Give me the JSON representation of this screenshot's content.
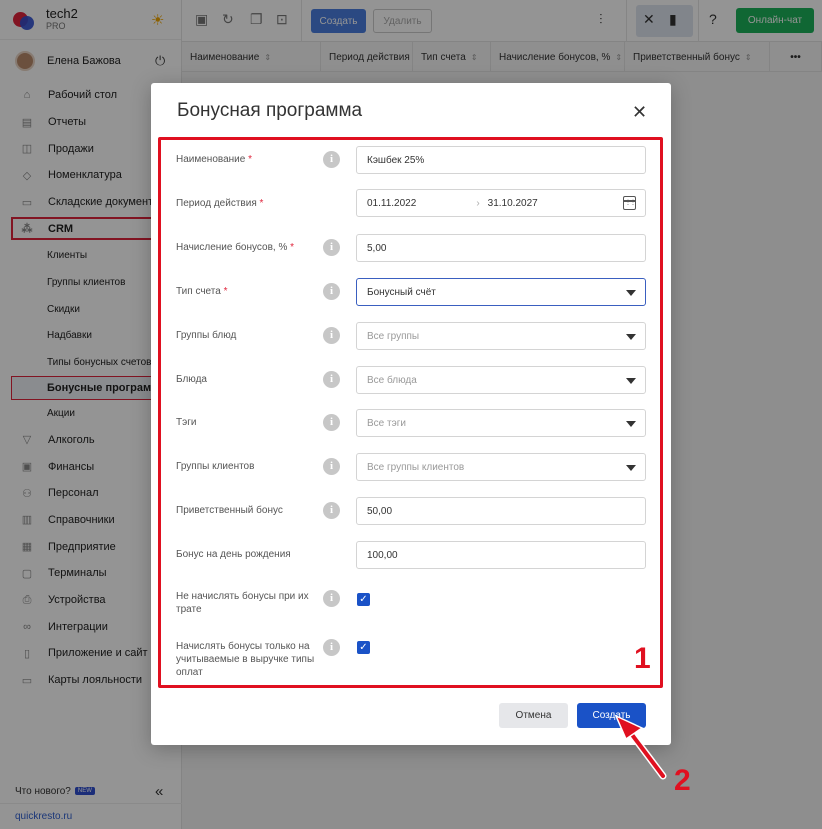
{
  "brand": {
    "name": "tech2",
    "plan": "PRO"
  },
  "user": {
    "name": "Елена Бажова"
  },
  "sidebar": {
    "items": [
      {
        "label": "Рабочий стол",
        "icon": "dashboard-icon"
      },
      {
        "label": "Отчеты",
        "icon": "reports-icon"
      },
      {
        "label": "Продажи",
        "icon": "sales-icon"
      },
      {
        "label": "Номенклатура",
        "icon": "nomenclature-icon"
      },
      {
        "label": "Складские документы",
        "icon": "warehouse-icon"
      },
      {
        "label": "CRM",
        "icon": "crm-icon"
      }
    ],
    "crm_sub": [
      "Клиенты",
      "Группы клиентов",
      "Скидки",
      "Надбавки",
      "Типы бонусных счетов",
      "Бонусные программы",
      "Акции"
    ],
    "items_after": [
      {
        "label": "Алкоголь",
        "icon": "alcohol-icon"
      },
      {
        "label": "Финансы",
        "icon": "finance-icon"
      },
      {
        "label": "Персонал",
        "icon": "staff-icon"
      },
      {
        "label": "Справочники",
        "icon": "reference-icon"
      },
      {
        "label": "Предприятие",
        "icon": "enterprise-icon"
      },
      {
        "label": "Терминалы",
        "icon": "terminal-icon"
      },
      {
        "label": "Устройства",
        "icon": "devices-icon"
      },
      {
        "label": "Интеграции",
        "icon": "integrations-icon"
      },
      {
        "label": "Приложение и сайт",
        "icon": "app-site-icon"
      },
      {
        "label": "Карты лояльности",
        "icon": "loyalty-cards-icon"
      }
    ],
    "whats_new": "Что нового?",
    "new_badge": "NEW",
    "site_link": "quickresto.ru"
  },
  "toolbar": {
    "create_label": "Создать",
    "delete_label": "Удалить",
    "chat_label": "Онлайн-чат"
  },
  "table": {
    "columns": [
      "Наименование",
      "Период действия",
      "Тип счета",
      "Начисление бонусов, %",
      "Приветственный бонус"
    ],
    "more": "•••"
  },
  "modal": {
    "title": "Бонусная программа",
    "fields": {
      "name": {
        "label": "Наименование",
        "value": "Кэшбек 25%"
      },
      "period": {
        "label": "Период действия",
        "from": "01.11.2022",
        "to": "31.10.2027",
        "sep": "›"
      },
      "accrual": {
        "label": "Начисление бонусов, %",
        "value": "5,00"
      },
      "account_type": {
        "label": "Тип счета",
        "value": "Бонусный счёт"
      },
      "dish_groups": {
        "label": "Группы блюд",
        "placeholder": "Все группы"
      },
      "dishes": {
        "label": "Блюда",
        "placeholder": "Все блюда"
      },
      "tags": {
        "label": "Тэги",
        "placeholder": "Все тэги"
      },
      "client_groups": {
        "label": "Группы клиентов",
        "placeholder": "Все группы клиентов"
      },
      "welcome_bonus": {
        "label": "Приветственный бонус",
        "value": "50,00"
      },
      "birthday_bonus": {
        "label": "Бонус на день рождения",
        "value": "100,00"
      },
      "no_accrual_on_spend": {
        "label": "Не начислять бонусы при их трате",
        "checked": true
      },
      "accrual_only_revenue": {
        "label": "Начислять бонусы только на учитываемые в выручке типы оплат",
        "checked": true
      }
    },
    "required_mark": "*",
    "cancel_label": "Отмена",
    "create_label": "Создать"
  },
  "annotations": {
    "frame_number": "1",
    "arrow_number": "2",
    "color": "#e01020"
  }
}
